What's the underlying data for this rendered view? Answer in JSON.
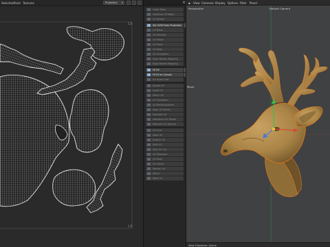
{
  "uv_editor": {
    "menu": [
      "Selection",
      "Paint",
      "Textures"
    ],
    "projection_select": "Projection",
    "coordinate_labels": {
      "top_right": "1,0",
      "bottom_right": "1,0"
    }
  },
  "command_palette": {
    "commands": [
      {
        "label": "Layer Tools",
        "state": "dim"
      },
      {
        "label": "Optimize UV Maps",
        "state": "dim"
      },
      {
        "label": "UV Terrain",
        "state": "dim"
      },
      {
        "label": "Set UVW From Projection",
        "state": "active"
      },
      {
        "label": "UV Relax",
        "state": "dim"
      },
      {
        "label": "UV Packing",
        "state": "dim"
      },
      {
        "label": "UV Mirror",
        "state": "dim"
      },
      {
        "label": "UV Mesh",
        "state": "dim"
      },
      {
        "label": "UV Align",
        "state": "dim"
      },
      {
        "label": "UV Straighten",
        "state": "dim"
      },
      {
        "label": "Snap Border Mapping",
        "state": "dim"
      },
      {
        "label": "Edge Border Mapping",
        "state": "dim"
      },
      {
        "label": "Fit UV",
        "state": "active"
      },
      {
        "label": "Fit UV to Canvas",
        "state": "active"
      },
      {
        "label": "UV Scale Grid",
        "state": "dim"
      },
      {
        "label": "Rotate UV",
        "state": "dim"
      },
      {
        "label": "Scale UV",
        "state": "dim"
      },
      {
        "label": "Mirror UV",
        "state": "dim"
      },
      {
        "label": "UV Transform",
        "state": "dim"
      },
      {
        "label": "UV Rectangularize",
        "state": "dim"
      },
      {
        "label": "Align UV Points",
        "state": "dim"
      },
      {
        "label": "Equalize UV",
        "state": "dim"
      },
      {
        "label": "Distribute UV Points",
        "state": "dim"
      },
      {
        "label": "Relocate UV Islands",
        "state": "dim"
      },
      {
        "label": "UV Grid",
        "state": "dim"
      },
      {
        "label": "Align UV",
        "state": "dim"
      },
      {
        "label": "Detach UV",
        "state": "dim"
      },
      {
        "label": "Shift UV",
        "state": "dim"
      },
      {
        "label": "Split UV Cut",
        "state": "dim"
      },
      {
        "label": "UV Selection",
        "state": "dim"
      },
      {
        "label": "UV Shell",
        "state": "dim"
      },
      {
        "label": "UV Island",
        "state": "dim"
      },
      {
        "label": "Seams Cut",
        "state": "dim"
      },
      {
        "label": "Stitch",
        "state": "dim"
      },
      {
        "label": "Weld UV",
        "state": "dim"
      }
    ]
  },
  "viewport": {
    "menu": [
      "View",
      "Cameras",
      "Display",
      "Options",
      "Filter",
      "Panel"
    ],
    "view_name": "Perspective",
    "camera_name": "Default Camera",
    "tool_label": "Move",
    "status": "View Transform: Scene",
    "colors": {
      "background": "#404143",
      "model": "#b48d4f",
      "selection_outline": "#e07a1f",
      "axis_y": "#3bbf4a",
      "axis_x": "#d64a3a",
      "axis_z": "#4a7ad6"
    }
  }
}
